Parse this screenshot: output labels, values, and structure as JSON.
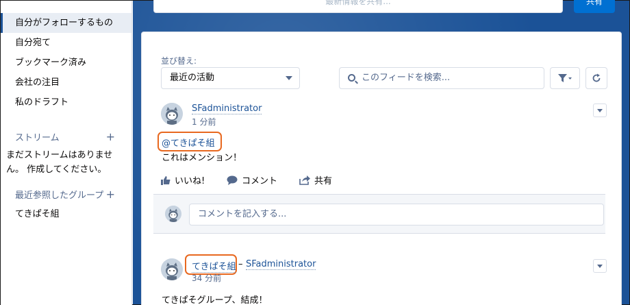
{
  "sidebar": {
    "items": [
      {
        "label": "自分がフォローするもの",
        "active": true
      },
      {
        "label": "自分宛て"
      },
      {
        "label": "ブックマーク済み"
      },
      {
        "label": "会社の注目"
      },
      {
        "label": "私のドラフト"
      }
    ],
    "streams": {
      "title": "ストリーム",
      "empty": "まだストリームはありません。 作成してください。"
    },
    "groups": {
      "title": "最近参照したグループ",
      "items": [
        "てきぱそ組"
      ]
    }
  },
  "top": {
    "share_box": "最新情報を共有...",
    "share_button": "共有"
  },
  "feed": {
    "sort_label": "並び替え:",
    "sort_value": "最近の活動",
    "search_placeholder": "このフィードを検索...",
    "posts": [
      {
        "author": "SFadministrator",
        "time": "1 分前",
        "mention": "@てきぱそ組",
        "body": "これはメンション！"
      },
      {
        "group": "てきぱそ組",
        "separator": "–",
        "author": "SFadministrator",
        "time": "34 分前",
        "body": "てきぱそグループ、結成！"
      }
    ],
    "actions": {
      "like": "いいね!",
      "comment": "コメント",
      "share": "共有"
    },
    "comment_placeholder": "コメントを記入する..."
  },
  "colors": {
    "brand": "#1b5297",
    "highlight": "#e8681f",
    "link": "#1b5297"
  }
}
